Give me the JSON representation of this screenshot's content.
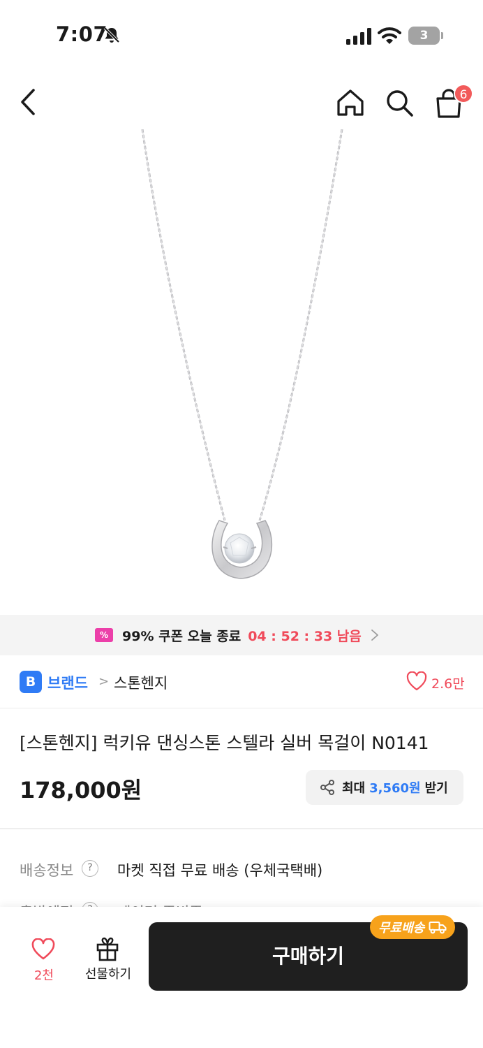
{
  "status_bar": {
    "time": "7:07",
    "battery_level": "3"
  },
  "nav": {
    "cart_count": "6"
  },
  "coupon": {
    "text": "99% 쿠폰 오늘 종료",
    "timer": "04 : 52 : 33 남음"
  },
  "brand": {
    "badge": "B",
    "label": "브랜드",
    "separator": ">",
    "name": "스톤헨지",
    "likes": "2.6만"
  },
  "product": {
    "title": "[스톤헨지] 럭키유 댄싱스톤 스텔라 실버 목걸이 N0141",
    "price": "178,000원",
    "points": {
      "prefix": "최대",
      "amount": "3,560원",
      "suffix": "받기"
    }
  },
  "info": [
    {
      "label": "배송정보",
      "value": "마켓 직접 무료 배송 (우체국택배)"
    },
    {
      "label": "출발예정",
      "value": "데이터 준비중"
    }
  ],
  "help_mark": "?",
  "bottom_bar": {
    "wish_count": "2천",
    "gift_label": "선물하기",
    "buy_label": "구매하기",
    "free_shipping_label": "무료배송"
  },
  "colors": {
    "accent_red": "#f04a5a",
    "brand_blue": "#2f7bf5",
    "coupon_pink": "#ec3fa9",
    "badge_orange": "#f7a21b"
  }
}
